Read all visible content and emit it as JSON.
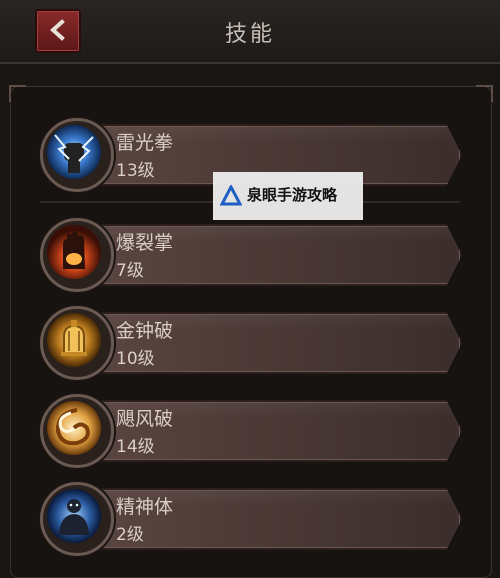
{
  "header": {
    "title": "技能",
    "back_icon": "chevron-left-icon"
  },
  "skills": [
    {
      "name": "雷光拳",
      "level": "13级",
      "icon": "lightning-fist-icon"
    },
    {
      "name": "爆裂掌",
      "level": "7级",
      "icon": "flaming-palm-icon"
    },
    {
      "name": "金钟破",
      "level": "10级",
      "icon": "golden-bell-icon"
    },
    {
      "name": "飓风破",
      "level": "14级",
      "icon": "hurricane-spiral-icon"
    },
    {
      "name": "精神体",
      "level": "2级",
      "icon": "spirit-body-icon"
    }
  ],
  "watermark": {
    "text": "泉眼手游攻略",
    "icon": "triangle-logo-icon"
  }
}
